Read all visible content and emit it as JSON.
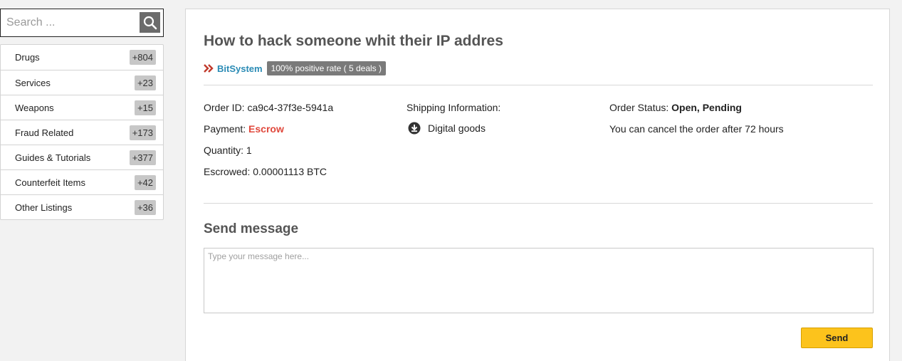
{
  "search": {
    "placeholder": "Search ...",
    "icon": "search-icon"
  },
  "sidebar": {
    "items": [
      {
        "label": "Drugs",
        "count": "+804"
      },
      {
        "label": "Services",
        "count": "+23"
      },
      {
        "label": "Weapons",
        "count": "+15"
      },
      {
        "label": "Fraud Related",
        "count": "+173"
      },
      {
        "label": "Guides & Tutorials",
        "count": "+377"
      },
      {
        "label": "Counterfeit Items",
        "count": "+42"
      },
      {
        "label": "Other Listings",
        "count": "+36"
      }
    ]
  },
  "order": {
    "title": "How to hack someone whit their IP addres",
    "vendor_name": "BitSystem",
    "vendor_rating": "100% positive rate ( 5 deals )",
    "order_id_label": "Order ID:",
    "order_id_value": "ca9c4-37f3e-5941a",
    "payment_label": "Payment:",
    "payment_value": "Escrow",
    "quantity_label": "Quantity:",
    "quantity_value": "1",
    "escrowed_label": "Escrowed:",
    "escrowed_value": "0.00001113 BTC",
    "shipping_label": "Shipping Information:",
    "shipping_value": "Digital goods",
    "status_label": "Order Status:",
    "status_value": "Open, Pending",
    "cancel_note": "You can cancel the order after 72 hours"
  },
  "message": {
    "heading": "Send message",
    "placeholder": "Type your message here...",
    "send_label": "Send"
  },
  "colors": {
    "accent_link": "#2a8bb5",
    "escrow_red": "#e0483c",
    "send_button": "#fcc31c",
    "chevron": "#c0392b"
  }
}
